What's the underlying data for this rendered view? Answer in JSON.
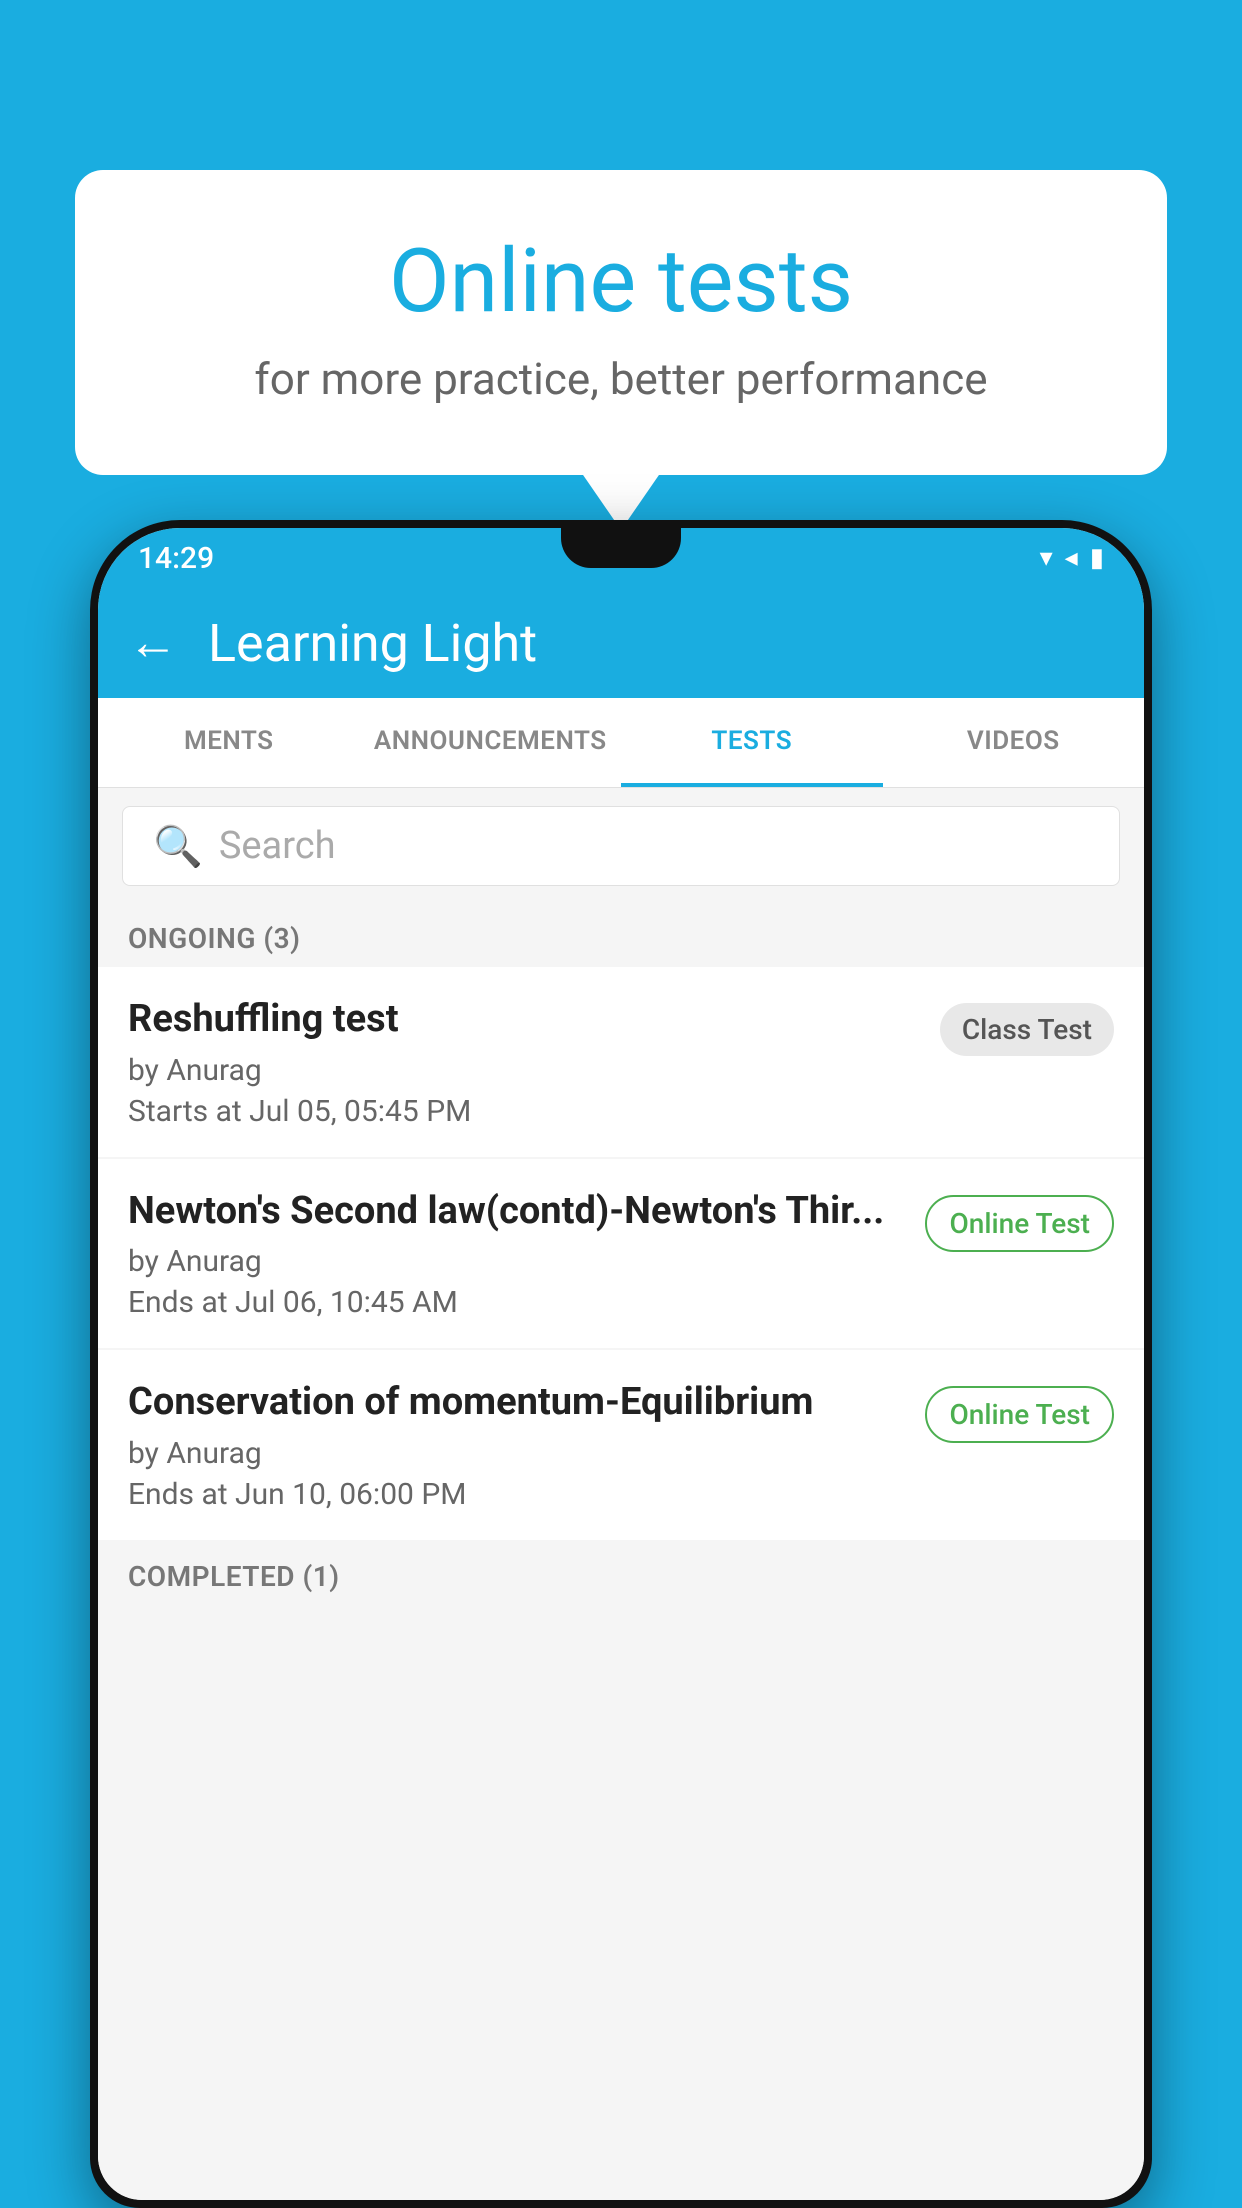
{
  "background": {
    "color": "#1AADE0"
  },
  "bubble": {
    "title": "Online tests",
    "subtitle": "for more practice, better performance"
  },
  "statusBar": {
    "time": "14:29",
    "icons": [
      "▼",
      "◀",
      "▮"
    ]
  },
  "appBar": {
    "title": "Learning Light",
    "backLabel": "←"
  },
  "tabs": [
    {
      "label": "MENTS",
      "active": false
    },
    {
      "label": "ANNOUNCEMENTS",
      "active": false
    },
    {
      "label": "TESTS",
      "active": true
    },
    {
      "label": "VIDEOS",
      "active": false
    }
  ],
  "search": {
    "placeholder": "Search"
  },
  "sections": [
    {
      "title": "ONGOING (3)",
      "tests": [
        {
          "title": "Reshuffling test",
          "by": "by Anurag",
          "time": "Starts at  Jul 05, 05:45 PM",
          "badge": "Class Test",
          "badgeType": "class"
        },
        {
          "title": "Newton's Second law(contd)-Newton's Thir...",
          "by": "by Anurag",
          "time": "Ends at  Jul 06, 10:45 AM",
          "badge": "Online Test",
          "badgeType": "online"
        },
        {
          "title": "Conservation of momentum-Equilibrium",
          "by": "by Anurag",
          "time": "Ends at  Jun 10, 06:00 PM",
          "badge": "Online Test",
          "badgeType": "online"
        }
      ]
    },
    {
      "title": "COMPLETED (1)",
      "tests": []
    }
  ]
}
